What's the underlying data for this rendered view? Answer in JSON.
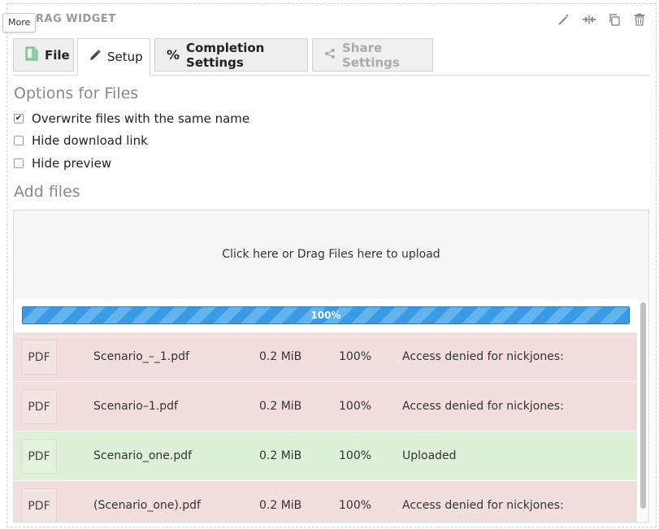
{
  "widget": {
    "title": "RAG WIDGET",
    "tooltip": "More",
    "header_icons": [
      "magic-wand-icon",
      "compress-icon",
      "copy-icon",
      "trash-icon"
    ]
  },
  "tabs": [
    {
      "label": "File",
      "icon": "file-icon",
      "active": false,
      "disabled": false
    },
    {
      "label": "Setup",
      "icon": "pencil-icon",
      "active": true,
      "disabled": false
    },
    {
      "label": "Completion Settings",
      "icon": "percent-icon",
      "active": false,
      "disabled": false
    },
    {
      "label": "Share Settings",
      "icon": "share-icon",
      "active": false,
      "disabled": true
    }
  ],
  "options": {
    "title": "Options for Files",
    "items": [
      {
        "label": "Overwrite files with the same name",
        "checked": true
      },
      {
        "label": "Hide download link",
        "checked": false
      },
      {
        "label": "Hide preview",
        "checked": false
      }
    ]
  },
  "add_files": {
    "title": "Add files",
    "dropzone_text": "Click here or Drag Files here to upload",
    "progress_label": "100%",
    "progress_value": 1.0
  },
  "files": [
    {
      "type": "PDF",
      "name": "Scenario_–_1.pdf",
      "size": "0.2 MiB",
      "percent": "100%",
      "status": "Access denied for nickjones:",
      "state": "error"
    },
    {
      "type": "PDF",
      "name": "Scenario–1.pdf",
      "size": "0.2 MiB",
      "percent": "100%",
      "status": "Access denied for nickjones:",
      "state": "error"
    },
    {
      "type": "PDF",
      "name": "Scenario_one.pdf",
      "size": "0.2 MiB",
      "percent": "100%",
      "status": "Uploaded",
      "state": "ok"
    },
    {
      "type": "PDF",
      "name": "(Scenario_one).pdf",
      "size": "0.2 MiB",
      "percent": "100%",
      "status": "Access denied for nickjones:",
      "state": "error"
    }
  ],
  "colors": {
    "error_row": "#f2dede",
    "success_row": "#dff0d8",
    "progress_bar": "#3a9ae4"
  }
}
